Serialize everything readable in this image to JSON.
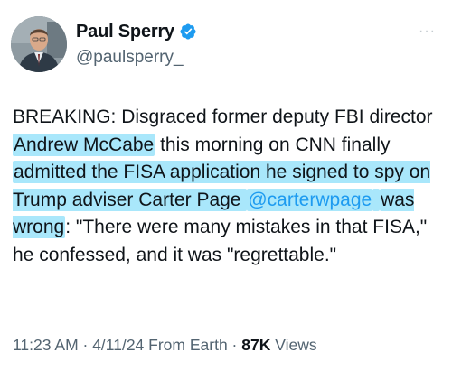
{
  "author": {
    "display_name": "Paul Sperry",
    "handle": "@paulsperry_",
    "verified_icon": "verified-badge-icon",
    "avatar_icon": "user-avatar-photo"
  },
  "more_options_label": "···",
  "tweet": {
    "segments": [
      "BREAKING: Disgraced former deputy FBI director ",
      "Andrew McCabe",
      " this morning on CNN finally ",
      "admitted the FISA application he signed to spy on Trump adviser Carter Page ",
      "@carterwpage",
      " ",
      "was wrong",
      ": \"There were many mistakes in that FISA,\" he confessed, and it was \"regrettable.\""
    ]
  },
  "meta": {
    "time": "11:23 AM",
    "sep1": " · ",
    "date": "4/11/24",
    "source": " From Earth",
    "sep2": " · ",
    "views_count": "87K",
    "views_label": " Views"
  },
  "colors": {
    "highlight": "#a9e7fb",
    "mention": "#1d9bf0",
    "verified": "#1d9bf0",
    "secondary_text": "#536471"
  }
}
